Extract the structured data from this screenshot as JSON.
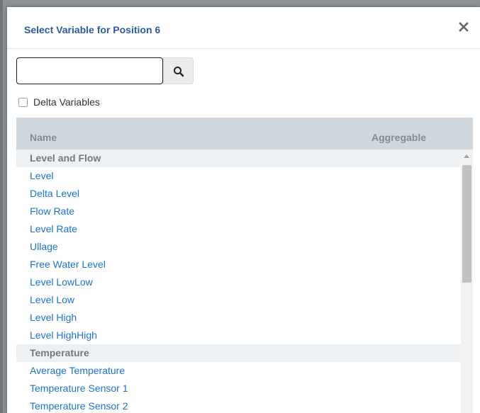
{
  "dialog": {
    "title": "Select Variable for Position 6",
    "close_icon": "close-icon"
  },
  "search": {
    "value": "",
    "placeholder": "",
    "icon": "search-icon"
  },
  "delta_checkbox": {
    "label": "Delta Variables",
    "checked": false
  },
  "table": {
    "columns": [
      "Name",
      "Aggregable"
    ],
    "groups": [
      {
        "name": "Level and Flow",
        "items": [
          "Level",
          "Delta Level",
          "Flow Rate",
          "Level Rate",
          "Ullage",
          "Free Water Level",
          "Level LowLow",
          "Level Low",
          "Level High",
          "Level HighHigh"
        ]
      },
      {
        "name": "Temperature",
        "items": [
          "Average Temperature",
          "Temperature Sensor 1",
          "Temperature Sensor 2"
        ]
      }
    ]
  },
  "colors": {
    "title": "#2d5aa0",
    "link": "#1a73d9",
    "header_bg": "#d0d8de",
    "group_bg": "#eef1f3"
  }
}
